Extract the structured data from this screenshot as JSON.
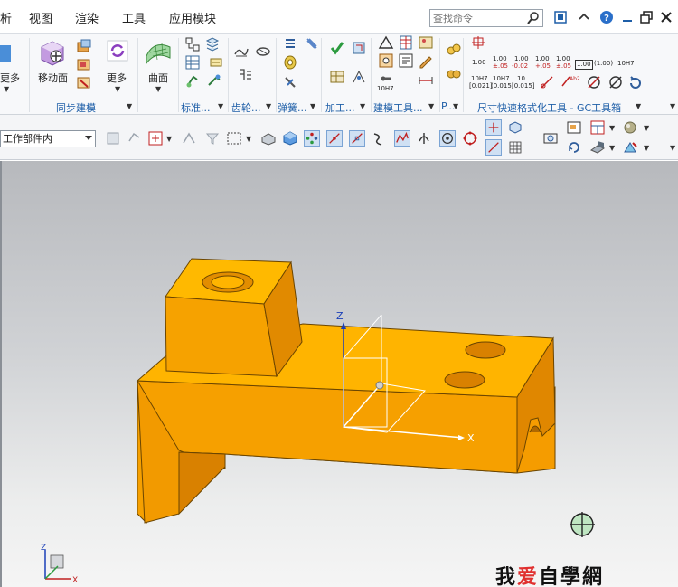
{
  "menu": {
    "items": [
      "析",
      "视图",
      "渲染",
      "工具",
      "应用模块"
    ],
    "search_placeholder": "查找命令"
  },
  "ribbon": {
    "more_left_label": "更多",
    "move_face_label": "移动面",
    "more_label": "更多",
    "surface_label": "曲面",
    "groups": {
      "sync_modeling": "同步建模",
      "standard": "标准...",
      "gear": "齿轮...",
      "spring": "弹簧...",
      "machining": "加工...",
      "modeling_tools": "建模工具...",
      "p": "P...",
      "dim_format": "尺寸快速格式化工具 - GC工具箱"
    },
    "dims": {
      "d1": "1.00",
      "d2": "1.00",
      "d2b": "±.05",
      "d3": "1.00",
      "d3b": "-0.02",
      "d4": "1.00",
      "d4b": "+.05",
      "d5": "1.00",
      "d5b": "±.05",
      "d6": "1.00",
      "d7": "(1.00)",
      "d8": "10H7",
      "t1a": "10H7",
      "t1b": "[0.021]",
      "t2a": "10H7",
      "t2b": "(0.015)",
      "t3a": "10",
      "t3b": "[0.015]",
      "small_10h7": "10H7",
      "red_label": "Ab2"
    }
  },
  "toolbar2": {
    "filter_value": "工作部件内"
  },
  "viewport": {
    "axis_x": "X",
    "axis_z": "Z",
    "triad_x": "X",
    "triad_z": "Z",
    "model_color": "#f5a300",
    "watermark_a": "我",
    "watermark_love": "爱",
    "watermark_b": "自學網"
  },
  "colors": {
    "accent_blue": "#1f5fa8",
    "model_face_top": "#ffb400",
    "model_face_front": "#f59c00",
    "model_face_side": "#d97f00"
  }
}
